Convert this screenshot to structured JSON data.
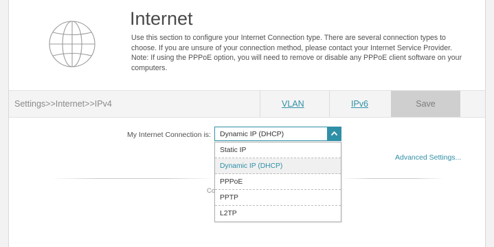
{
  "header": {
    "title": "Internet",
    "description": "Use this section to configure your Internet Connection type. There are several connection types to choose. If you are unsure of your connection method, please contact your Internet Service Provider. Note: If using the PPPoE option, you will need to remove or disable any PPPoE client software on your computers.",
    "icon": "globe-icon"
  },
  "navbar": {
    "breadcrumb": "Settings>>Internet>>IPv4",
    "vlan_label": "VLAN",
    "ipv6_label": "IPv6",
    "save_label": "Save"
  },
  "connection": {
    "label": "My Internet Connection is:",
    "selected": "Dynamic IP (DHCP)",
    "options": [
      {
        "label": "Static IP"
      },
      {
        "label": "Dynamic IP (DHCP)"
      },
      {
        "label": "PPPoE"
      },
      {
        "label": "PPTP"
      },
      {
        "label": "L2TP"
      }
    ]
  },
  "advanced_settings": "Advanced Settings...",
  "partially_hidden_text": "Co",
  "colors": {
    "accent": "#2f8fa6",
    "save_bg": "#cfcfcf",
    "selected_option_bg": "#f0f0f0"
  }
}
